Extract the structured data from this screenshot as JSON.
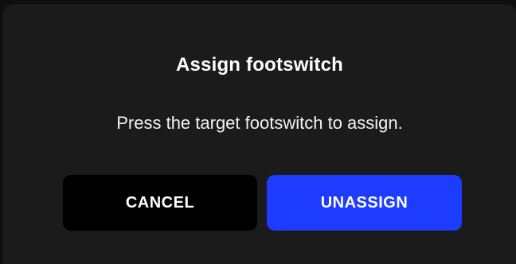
{
  "dialog": {
    "title": "Assign footswitch",
    "message": "Press the target footswitch to assign.",
    "buttons": {
      "cancel_label": "CANCEL",
      "unassign_label": "UNASSIGN"
    }
  },
  "colors": {
    "background": "#1b1b1b",
    "cancel_button": "#000000",
    "unassign_button": "#1e3cff",
    "text": "#ffffff"
  }
}
